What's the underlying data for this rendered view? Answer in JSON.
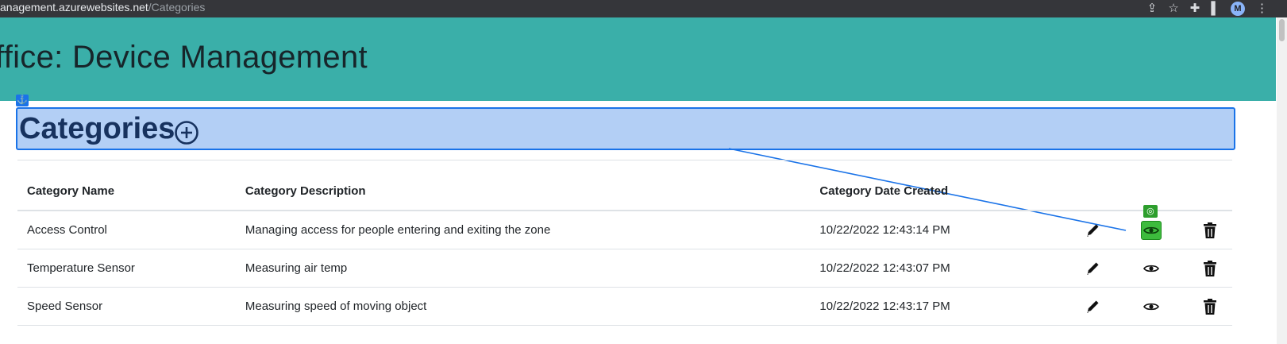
{
  "browser": {
    "url_host": "anagement.azurewebsites.net",
    "url_path": "/Categories",
    "profile_initial": "M",
    "icons": [
      "share-icon",
      "star-icon",
      "extensions-icon",
      "sidebar-icon",
      "avatar",
      "more-icon"
    ]
  },
  "header": {
    "title": "ffice: Device Management",
    "background_color": "#3aafa9"
  },
  "categories": {
    "title": "Categories",
    "add_icon": "plus-circle-icon",
    "highlight_color": "#1a73e8"
  },
  "table": {
    "columns": [
      "Category Name",
      "Category Description",
      "Category Date Created"
    ],
    "rows": [
      {
        "name": "Access Control",
        "description": "Managing access for people entering and exiting the zone",
        "date": "10/22/2022 12:43:14 PM"
      },
      {
        "name": "Temperature Sensor",
        "description": "Measuring air temp",
        "date": "10/22/2022 12:43:07 PM"
      },
      {
        "name": "Speed Sensor",
        "description": "Measuring speed of moving object",
        "date": "10/22/2022 12:43:17 PM"
      }
    ],
    "row_actions": [
      "pencil-icon",
      "eye-icon",
      "trash-icon"
    ]
  }
}
